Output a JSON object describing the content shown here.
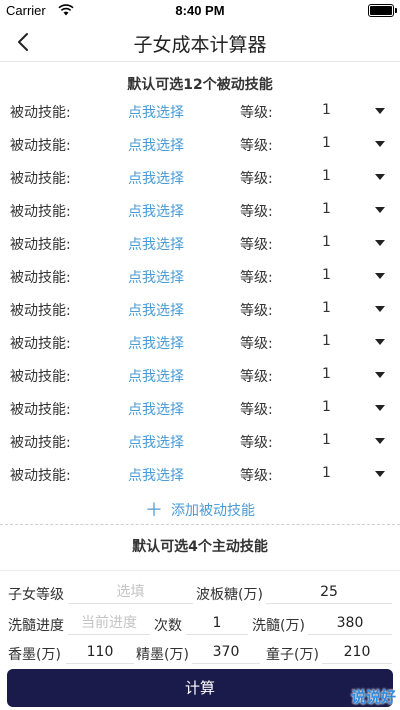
{
  "status_bar": {
    "carrier": "Carrier",
    "time": "8:40 PM"
  },
  "header": {
    "title": "子女成本计算器"
  },
  "passive_section": {
    "title": "默认可选12个被动技能",
    "rows": [
      {
        "label": "被动技能:",
        "pick": "点我选择",
        "level_label": "等级:",
        "level": "1"
      },
      {
        "label": "被动技能:",
        "pick": "点我选择",
        "level_label": "等级:",
        "level": "1"
      },
      {
        "label": "被动技能:",
        "pick": "点我选择",
        "level_label": "等级:",
        "level": "1"
      },
      {
        "label": "被动技能:",
        "pick": "点我选择",
        "level_label": "等级:",
        "level": "1"
      },
      {
        "label": "被动技能:",
        "pick": "点我选择",
        "level_label": "等级:",
        "level": "1"
      },
      {
        "label": "被动技能:",
        "pick": "点我选择",
        "level_label": "等级:",
        "level": "1"
      },
      {
        "label": "被动技能:",
        "pick": "点我选择",
        "level_label": "等级:",
        "level": "1"
      },
      {
        "label": "被动技能:",
        "pick": "点我选择",
        "level_label": "等级:",
        "level": "1"
      },
      {
        "label": "被动技能:",
        "pick": "点我选择",
        "level_label": "等级:",
        "level": "1"
      },
      {
        "label": "被动技能:",
        "pick": "点我选择",
        "level_label": "等级:",
        "level": "1"
      },
      {
        "label": "被动技能:",
        "pick": "点我选择",
        "level_label": "等级:",
        "level": "1"
      },
      {
        "label": "被动技能:",
        "pick": "点我选择",
        "level_label": "等级:",
        "level": "1"
      }
    ],
    "add_label": "添加被动技能"
  },
  "active_section": {
    "title": "默认可选4个主动技能"
  },
  "form": {
    "child_level": {
      "label": "子女等级",
      "placeholder": "选填",
      "value": ""
    },
    "boban_sugar": {
      "label": "波板糖(万)",
      "value": "25"
    },
    "xisui_progress": {
      "label": "洗髓进度",
      "placeholder": "当前进度",
      "value": ""
    },
    "times": {
      "label": "次数",
      "value": "1"
    },
    "xisui_cost": {
      "label": "洗髓(万)",
      "value": "380"
    },
    "xiangmo": {
      "label": "香墨(万)",
      "value": "110"
    },
    "jingmo": {
      "label": "精墨(万)",
      "value": "370"
    },
    "tongzi": {
      "label": "童子(万)",
      "value": "210"
    }
  },
  "calc_button": "计算",
  "watermark": "说说好",
  "icons": {
    "back": "chevron-left-icon",
    "wifi": "wifi-icon",
    "battery": "battery-icon",
    "dropdown": "caret-down-icon",
    "add": "plus-icon"
  },
  "colors": {
    "link": "#4a9bd4",
    "button_bg": "#1a1b4b",
    "button_text": "#ffffff"
  }
}
